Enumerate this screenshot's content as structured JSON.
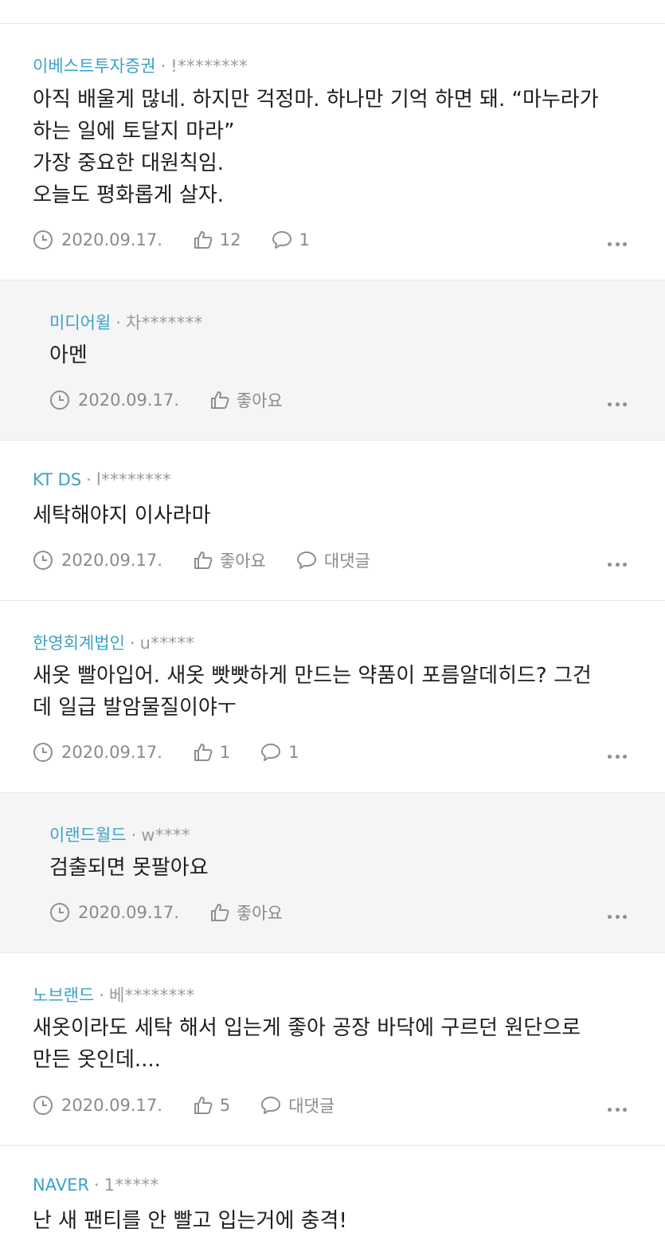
{
  "comments": [
    {
      "author": "이베스트투자증권",
      "uid": "!********",
      "text": "아직 배울게 많네. 하지만 걱정마. 하나만 기억 하면 돼. “마누라가\n하는 일에 토달지 마라”\n가장 중요한 대원칙임.\n오늘도 평화롭게 살자.",
      "date": "2020.09.17.",
      "likes": "12",
      "replies": "1"
    },
    {
      "author": "미디어윌",
      "uid": "차*******",
      "text": "아멘",
      "date": "2020.09.17.",
      "likes": "좋아요"
    },
    {
      "author": "KT DS",
      "uid": "l********",
      "text": "세탁해야지 이사라마",
      "date": "2020.09.17.",
      "likes": "좋아요",
      "replies": "대댓글"
    },
    {
      "author": "한영회계법인",
      "uid": "u*****",
      "text": "새옷 빨아입어. 새옷 빳빳하게 만드는 약품이 포름알데히드? 그건\n데 일급 발암물질이야ㅜ",
      "date": "2020.09.17.",
      "likes": "1",
      "replies": "1"
    },
    {
      "author": "이랜드월드",
      "uid": "w****",
      "text": "검출되면 못팔아요",
      "date": "2020.09.17.",
      "likes": "좋아요"
    },
    {
      "author": "노브랜드",
      "uid": "베********",
      "text": "새옷이라도 세탁 해서 입는게 좋아 공장 바닥에 구르던 원단으로\n만든 옷인데....",
      "date": "2020.09.17.",
      "likes": "5",
      "replies": "대댓글"
    },
    {
      "author": "NAVER",
      "uid": "1*****",
      "text": "난 새 팬티를 안 빨고 입는거에 충격!"
    }
  ],
  "colors": {
    "author": "#3aa3c5",
    "meta": "#8a8a8a",
    "reply_bg": "#f5f5f6"
  },
  "icons": {
    "date": "clock-icon",
    "like": "thumbs-up-icon",
    "reply": "speech-bubble-icon",
    "more": "more-dots-icon"
  }
}
